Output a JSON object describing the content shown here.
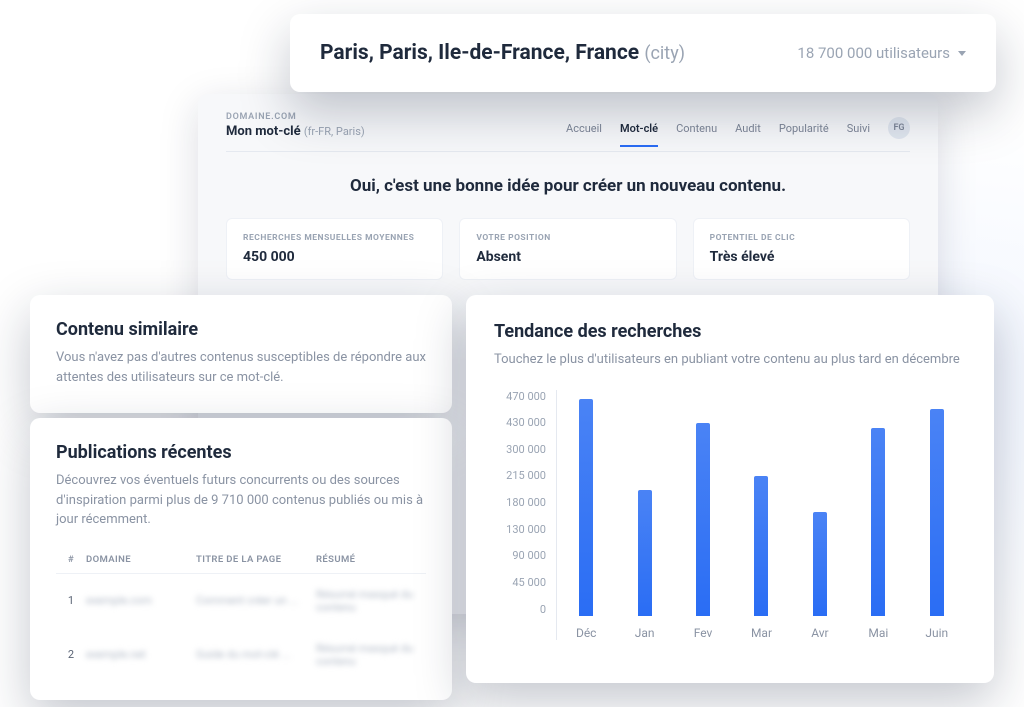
{
  "top": {
    "location": "Paris, Paris, Ile-de-France, France",
    "location_tag": "(city)",
    "users_label": "18 700 000 utilisateurs"
  },
  "back": {
    "domain_label": "DOMAINE.COM",
    "keyword": "Mon mot-clé",
    "keyword_meta": "(fr-FR, Paris)",
    "nav": {
      "accueil": "Accueil",
      "motcle": "Mot-clé",
      "contenu": "Contenu",
      "audit": "Audit",
      "popularite": "Popularité",
      "suivi": "Suivi"
    },
    "avatar": "FG",
    "headline": "Oui, c'est une bonne idée pour créer un nouveau contenu.",
    "metrics": {
      "searches": {
        "label": "RECHERCHES MENSUELLES MOYENNES",
        "value": "450 000"
      },
      "position": {
        "label": "VOTRE POSITION",
        "value": "Absent"
      },
      "potential": {
        "label": "POTENTIEL DE CLIC",
        "value": "Très élevé"
      }
    }
  },
  "similar": {
    "title": "Contenu similaire",
    "desc": "Vous n'avez pas d'autres contenus susceptibles de répondre aux attentes des utilisateurs sur ce mot-clé."
  },
  "publications": {
    "title": "Publications récentes",
    "desc": "Découvrez vos éventuels futurs concurrents ou des sources d'inspiration parmi plus de 9 710 000 contenus publiés ou mis à jour récemment.",
    "headers": {
      "idx": "#",
      "domain": "DOMAINE",
      "title": "TITRE DE LA PAGE",
      "summary": "RÉSUMÉ"
    },
    "rows": [
      {
        "i": "1",
        "domain": "exemple.com",
        "title": "Comment créer un ...",
        "summary": "Résumé masqué du contenu"
      },
      {
        "i": "2",
        "domain": "exemple.net",
        "title": "Guide du mot-clé ...",
        "summary": "Résumé masqué du contenu"
      }
    ]
  },
  "chart": {
    "title": "Tendance des recherches",
    "desc": "Touchez le plus d'utilisateurs en publiant votre contenu au plus tard en décembre"
  },
  "chart_data": {
    "type": "bar",
    "title": "Tendance des recherches",
    "categories": [
      "Déc",
      "Jan",
      "Fev",
      "Mar",
      "Avr",
      "Mai",
      "Juin"
    ],
    "values": [
      450000,
      260000,
      400000,
      290000,
      215000,
      390000,
      430000
    ],
    "ylabel": "",
    "xlabel": "",
    "ylim": [
      0,
      470000
    ],
    "y_ticks": [
      470000,
      430000,
      300000,
      215000,
      180000,
      130000,
      90000,
      45000,
      0
    ],
    "y_tick_labels": [
      "470 000",
      "430 000",
      "300 000",
      "215 000",
      "180 000",
      "130 000",
      "90 000",
      "45 000",
      "0"
    ]
  }
}
